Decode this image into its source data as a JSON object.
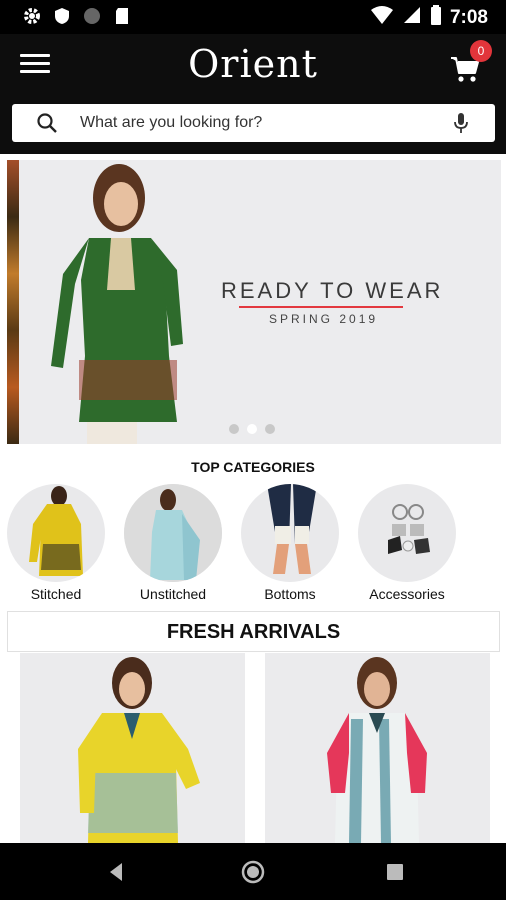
{
  "status_bar": {
    "time": "7:08",
    "left_icons": [
      "settings-icon",
      "shield-icon",
      "circle-icon",
      "sd-card-icon"
    ],
    "right_icons": [
      "wifi-icon",
      "signal-icon",
      "battery-icon"
    ]
  },
  "header": {
    "logo": "Orient",
    "cart_count": "0",
    "search_placeholder": "What are you looking for?"
  },
  "banner": {
    "title": "READY TO WEAR",
    "subtitle": "SPRING 2019",
    "slide_count": 3,
    "active_slide": 2
  },
  "categories": {
    "heading": "TOP CATEGORIES",
    "items": [
      {
        "label": "Stitched"
      },
      {
        "label": "Unstitched"
      },
      {
        "label": "Bottoms"
      },
      {
        "label": "Accessories"
      }
    ]
  },
  "fresh_arrivals": {
    "heading": "FRESH ARRIVALS"
  },
  "colors": {
    "header_bg": "#0d0d0d",
    "badge": "#e2353b",
    "accent_line": "#e3393f"
  }
}
